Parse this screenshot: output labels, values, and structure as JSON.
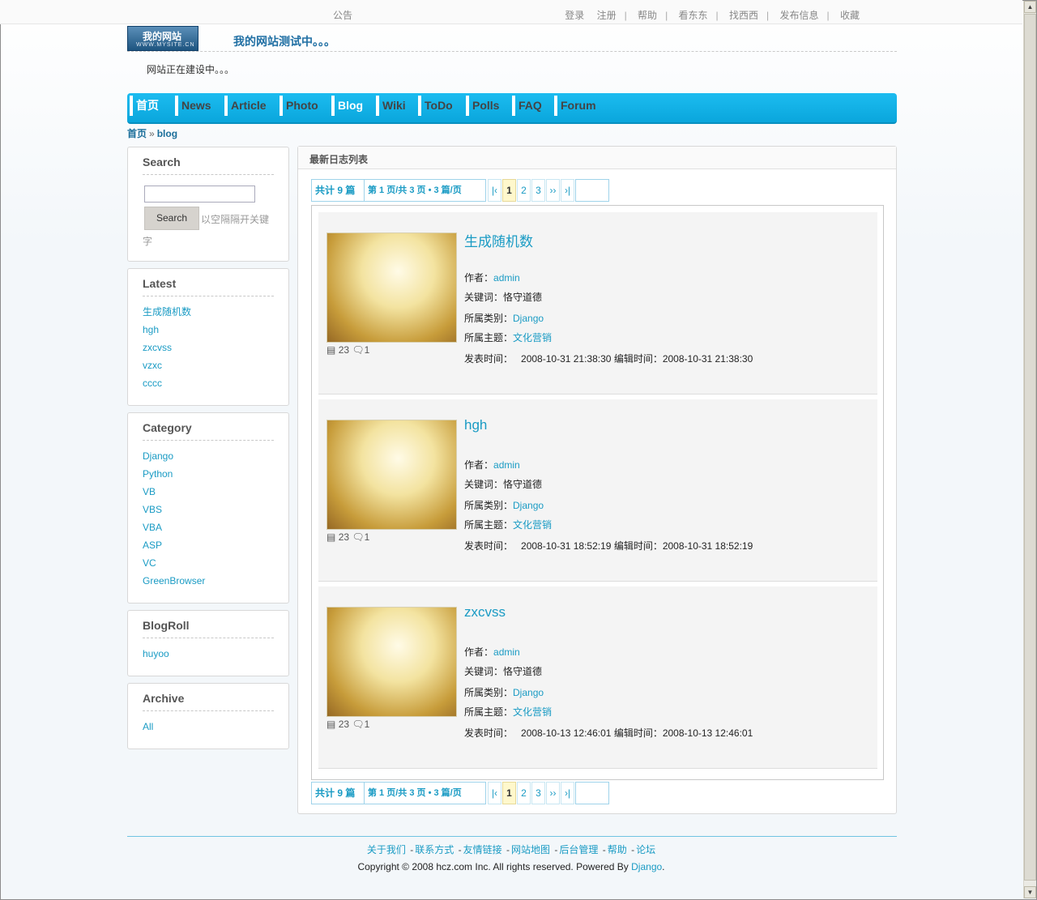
{
  "topbar": {
    "notice": "公告",
    "links": [
      "登录",
      "注册",
      "帮助",
      "看东东",
      "找西西",
      "发布信息",
      "收藏"
    ]
  },
  "header": {
    "logo_text": "我的网站",
    "logo_sub": "WWW.MYSITE.CN",
    "site_title": "我的网站测试中。。。",
    "site_message": "网站正在建设中。。。"
  },
  "nav": {
    "items": [
      "首页",
      "News",
      "Article",
      "Photo",
      "Blog",
      "Wiki",
      "ToDo",
      "Polls",
      "FAQ",
      "Forum"
    ],
    "active": [
      "首页",
      "Blog"
    ]
  },
  "breadcrumb": {
    "home": "首页",
    "sep": "»",
    "current": "blog"
  },
  "sidebar": {
    "search": {
      "title": "Search",
      "button": "Search",
      "hint": "以空隔隔开关键",
      "hint_cont": "字"
    },
    "latest": {
      "title": "Latest",
      "items": [
        "生成随机数",
        "hgh",
        "zxcvss",
        "vzxc",
        "cccc"
      ]
    },
    "category": {
      "title": "Category",
      "items": [
        "Django",
        "Python",
        "VB",
        "VBS",
        "VBA",
        "ASP",
        "VC",
        "GreenBrowser"
      ]
    },
    "blogroll": {
      "title": "BlogRoll",
      "items": [
        "huyoo"
      ]
    },
    "archive": {
      "title": "Archive",
      "items": [
        "All"
      ]
    }
  },
  "main": {
    "title": "最新日志列表",
    "pager": {
      "total": "共计  9 篇",
      "info": "第  1 页/共  3 页 • 3 篇/页",
      "first": "|‹",
      "pages": [
        "1",
        "2",
        "3"
      ],
      "current_page": "1",
      "next": "››",
      "last": "›|"
    },
    "labels": {
      "author": "作者：",
      "keywords": "关键词：",
      "category": "所属类别：",
      "topic": "所属主题：",
      "published": "发表时间：",
      "edited": "编辑时间："
    },
    "entries": [
      {
        "title": "生成随机数",
        "views": "23",
        "comments": "1",
        "author": "admin",
        "keywords": "恪守道德",
        "category": "Django",
        "topic": "文化营销",
        "published": "2008-10-31 21:38:30",
        "edited": "2008-10-31 21:38:30"
      },
      {
        "title": "hgh",
        "views": "23",
        "comments": "1",
        "author": "admin",
        "keywords": "恪守道德",
        "category": "Django",
        "topic": "文化营销",
        "published": "2008-10-31 18:52:19",
        "edited": "2008-10-31 18:52:19"
      },
      {
        "title": "zxcvss",
        "views": "23",
        "comments": "1",
        "author": "admin",
        "keywords": "恪守道德",
        "category": "Django",
        "topic": "文化营销",
        "published": "2008-10-13 12:46:01",
        "edited": "2008-10-13 12:46:01"
      }
    ]
  },
  "footer": {
    "links": [
      "关于我们",
      "联系方式",
      "友情链接",
      "网站地图",
      "后台管理",
      "帮助",
      "论坛"
    ],
    "link_sep": "-",
    "copyright": "Copyright © 2008 hcz.com Inc. All rights reserved. Powered By",
    "powered_by": "Django",
    "period": "."
  },
  "colors": {
    "link": "#1a9bc4",
    "nav_bg": "#0aa6dc",
    "footer_rule": "#6fc4e2"
  }
}
